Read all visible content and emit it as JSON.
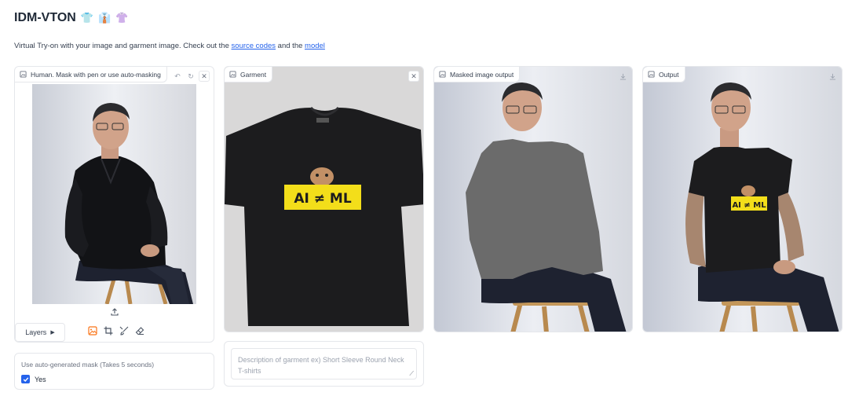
{
  "header": {
    "title": "IDM-VTON",
    "emojis": [
      "👕",
      "👔",
      "👚"
    ],
    "subtitle_prefix": "Virtual Try-on with your image and garment image. Check out the ",
    "link_source": "source codes",
    "subtitle_mid": " and the ",
    "link_model": "model"
  },
  "human_panel": {
    "label": "Human. Mask with pen or use auto-masking",
    "layers_label": "Layers"
  },
  "garment_panel": {
    "label": "Garment",
    "tshirt_text": "AI ≠ ML"
  },
  "masked_panel": {
    "label": "Masked image output"
  },
  "output_panel": {
    "label": "Output"
  },
  "auto_mask": {
    "label": "Use auto-generated mask (Takes 5 seconds)",
    "option": "Yes",
    "checked": true
  },
  "garment_description": {
    "placeholder": "Description of garment ex) Short Sleeve Round Neck T-shirts"
  },
  "colors": {
    "accent": "#2563eb",
    "tool_orange": "#f97316",
    "tshirt_black": "#1c1c1e",
    "tshirt_yellow": "#f3de1a",
    "mask_gray": "#6b6b6b"
  }
}
